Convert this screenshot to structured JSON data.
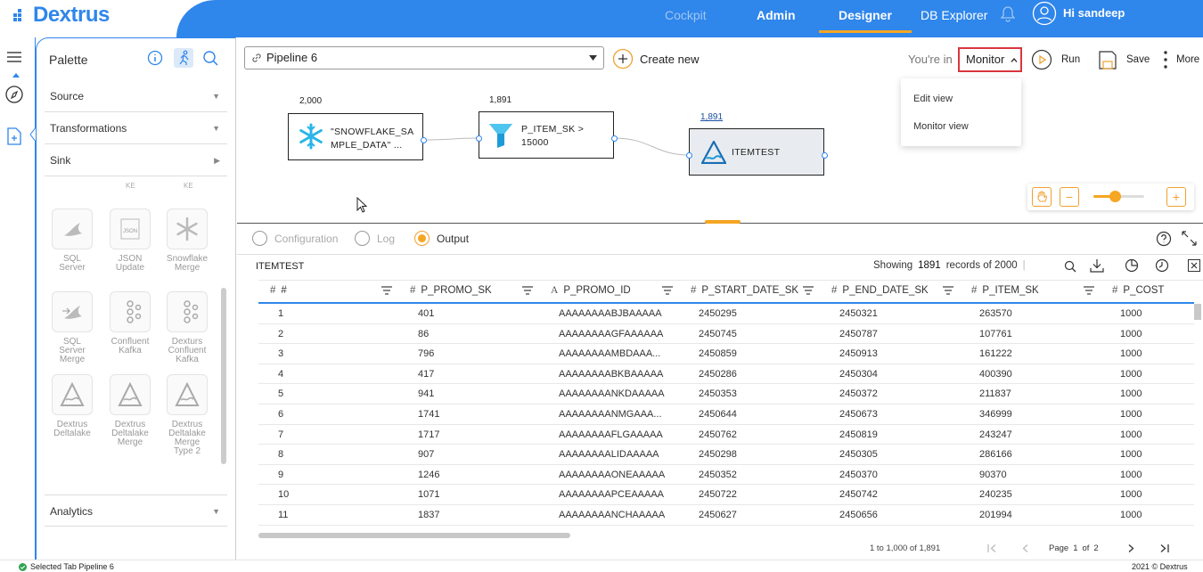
{
  "app": {
    "name": "Dextrus"
  },
  "nav": {
    "cockpit": "Cockpit",
    "admin": "Admin",
    "designer": "Designer",
    "db_explorer": "DB Explorer",
    "greeting": "Hi sandeep"
  },
  "palette": {
    "title": "Palette",
    "sections": {
      "source": "Source",
      "transformations": "Transformations",
      "sink": "Sink",
      "analytics": "Analytics"
    },
    "tiles_partial": [
      "KE",
      "KE"
    ],
    "tiles": [
      {
        "label": "SQL Server",
        "icon": "sql-server-icon"
      },
      {
        "label": "JSON Update",
        "icon": "json-icon"
      },
      {
        "label": "Snowflake Merge",
        "icon": "snowflake-icon"
      },
      {
        "label": "SQL Server Merge",
        "icon": "sql-server-merge-icon"
      },
      {
        "label": "Confluent Kafka",
        "icon": "kafka-icon"
      },
      {
        "label": "Dexturs Confluent Kafka",
        "icon": "kafka-icon"
      },
      {
        "label": "Dextrus Deltalake",
        "icon": "deltalake-icon"
      },
      {
        "label": "Dextrus Deltalake Merge",
        "icon": "deltalake-icon"
      },
      {
        "label": "Dextrus Deltalake Merge Type 2",
        "icon": "deltalake-icon"
      }
    ]
  },
  "toolbar": {
    "pipeline": "Pipeline 6",
    "create_new": "Create new",
    "youre_in": "You're in",
    "mode": "Monitor",
    "run": "Run",
    "save": "Save",
    "more": "More"
  },
  "mode_menu": {
    "items": [
      "Edit view",
      "Monitor view"
    ]
  },
  "pipeline": {
    "nodes": [
      {
        "count": "2,000",
        "label": "\"SNOWFLAKE_SA MPLE_DATA\" ...",
        "label1": "\"SNOWFLAKE_SA",
        "label2": "MPLE_DATA\" ..."
      },
      {
        "count": "1,891",
        "label1": "P_ITEM_SK >",
        "label2": "15000"
      },
      {
        "count": "1,891",
        "label1": "ITEMTEST"
      }
    ]
  },
  "tabs": {
    "configuration": "Configuration",
    "log": "Log",
    "output": "Output"
  },
  "output": {
    "name": "ITEMTEST",
    "showing_label": "Showing",
    "showing_count": "1891",
    "showing_suffix": "records of 2000",
    "columns": [
      "#",
      "P_PROMO_SK",
      "P_PROMO_ID",
      "P_START_DATE_SK",
      "P_END_DATE_SK",
      "P_ITEM_SK",
      "P_COST"
    ],
    "rows": [
      [
        "1",
        "401",
        "AAAAAAAABJBAAAAA",
        "2450295",
        "2450321",
        "263570",
        "1000"
      ],
      [
        "2",
        "86",
        "AAAAAAAAGFAAAAAA",
        "2450745",
        "2450787",
        "107761",
        "1000"
      ],
      [
        "3",
        "796",
        "AAAAAAAAMBDAAA...",
        "2450859",
        "2450913",
        "161222",
        "1000"
      ],
      [
        "4",
        "417",
        "AAAAAAAABKBAAAAA",
        "2450286",
        "2450304",
        "400390",
        "1000"
      ],
      [
        "5",
        "941",
        "AAAAAAAANKDAAAAA",
        "2450353",
        "2450372",
        "211837",
        "1000"
      ],
      [
        "6",
        "1741",
        "AAAAAAAANMGAAA...",
        "2450644",
        "2450673",
        "346999",
        "1000"
      ],
      [
        "7",
        "1717",
        "AAAAAAAAFLGAAAAA",
        "2450762",
        "2450819",
        "243247",
        "1000"
      ],
      [
        "8",
        "907",
        "AAAAAAAALIDAAAAA",
        "2450298",
        "2450305",
        "286166",
        "1000"
      ],
      [
        "9",
        "1246",
        "AAAAAAAAONEAAAAA",
        "2450352",
        "2450370",
        "90370",
        "1000"
      ],
      [
        "10",
        "1071",
        "AAAAAAAAPCEAAAAA",
        "2450722",
        "2450742",
        "240235",
        "1000"
      ],
      [
        "11",
        "1837",
        "AAAAAAAANCHAAAAA",
        "2450627",
        "2450656",
        "201994",
        "1000"
      ]
    ],
    "pager": {
      "range": "1 to 1,000 of 1,891",
      "page_label": "Page",
      "page": "1",
      "of": "of",
      "total": "2"
    }
  },
  "status": {
    "left": "Selected Tab Pipeline 6",
    "right": "2021 © Dextrus"
  },
  "colors": {
    "brand": "#2f86eb",
    "accent": "#f5a623",
    "highlight": "#d9363e"
  }
}
